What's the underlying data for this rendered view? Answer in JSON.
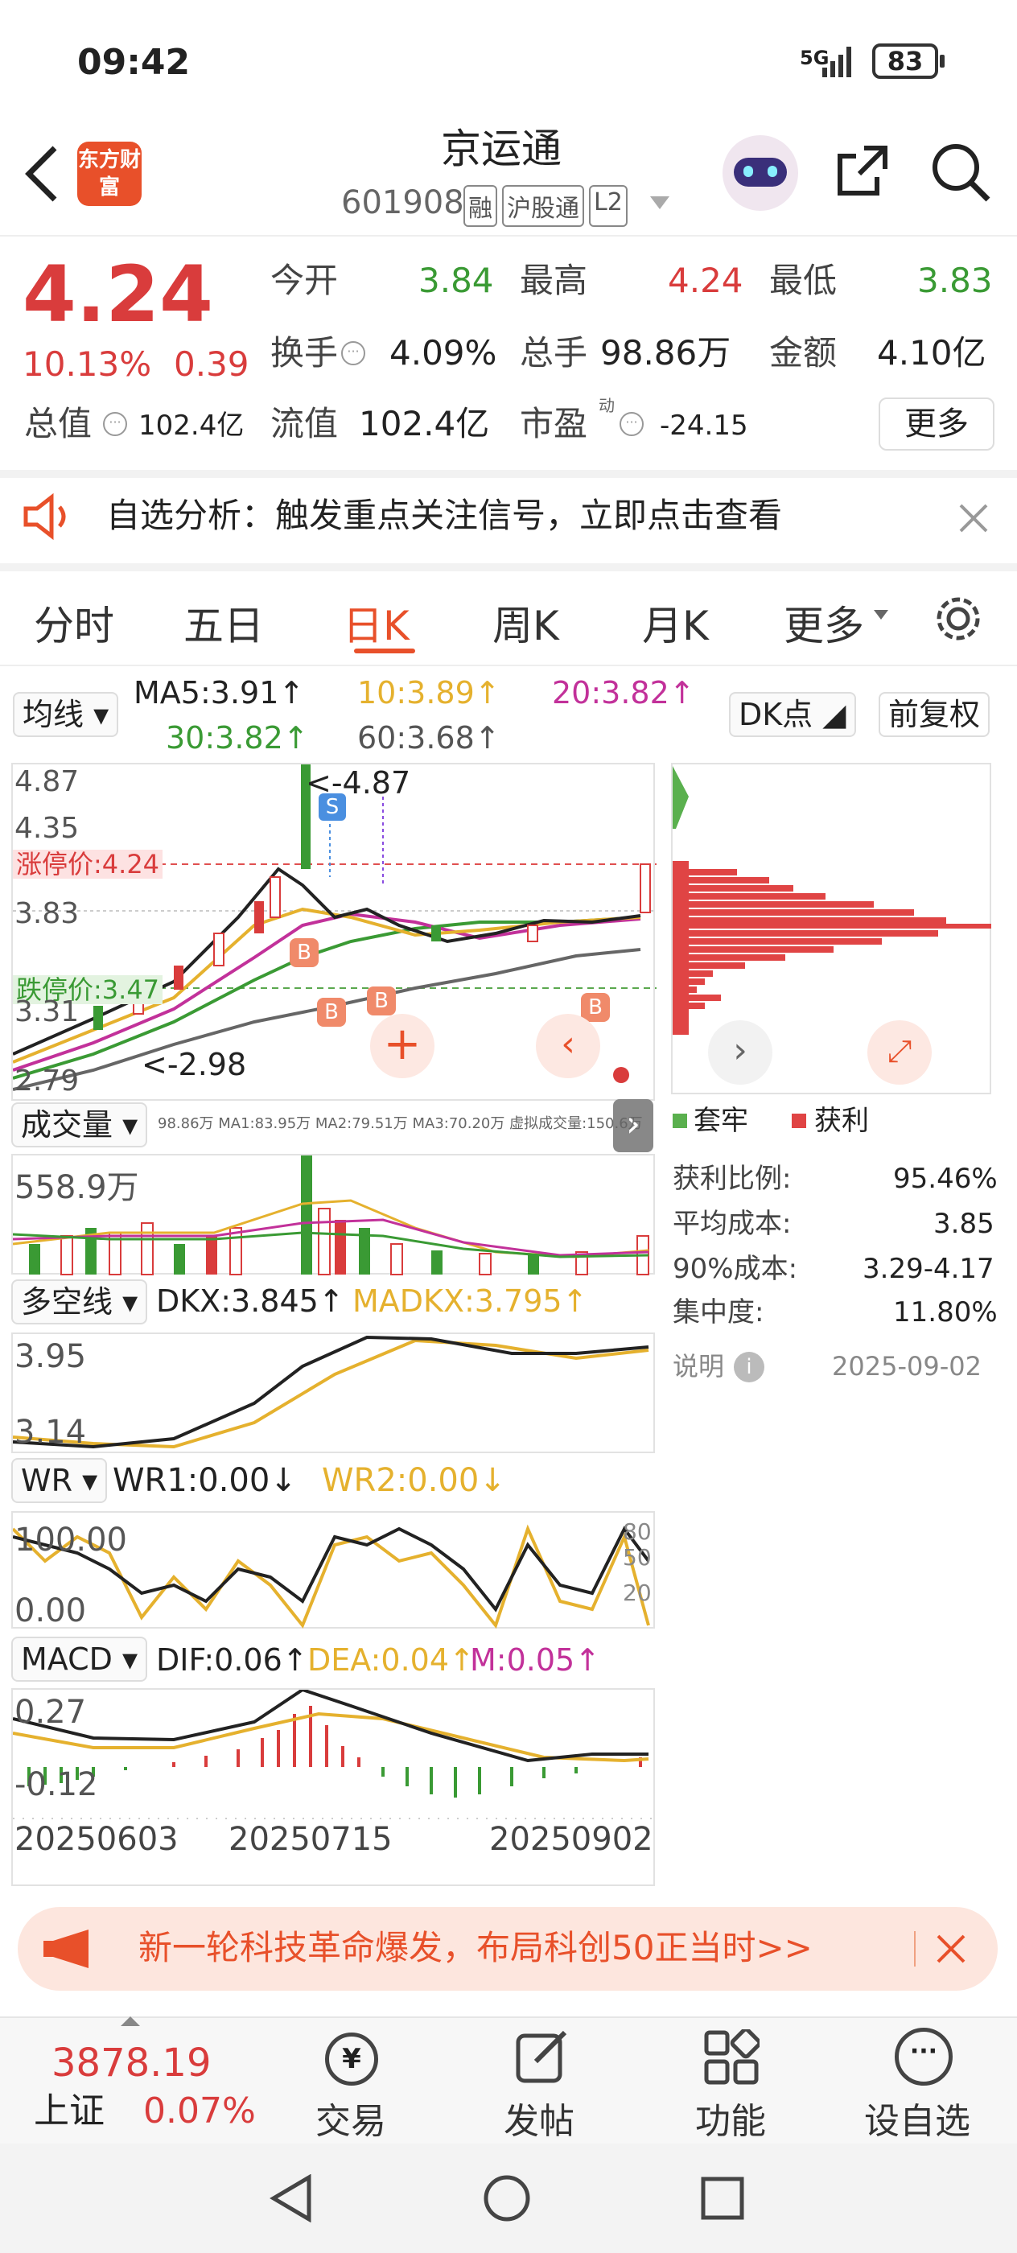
{
  "status": {
    "time": "09:42",
    "battery": "83",
    "network": "5G"
  },
  "header": {
    "title": "京运通",
    "code": "601908",
    "tags": [
      "融",
      "沪股通",
      "L2"
    ],
    "logo_text": "东方财富"
  },
  "quote": {
    "price": "4.24",
    "change_pct": "10.13%",
    "change": "0.39",
    "open_label": "今开",
    "open": "3.84",
    "high_label": "最高",
    "high": "4.24",
    "low_label": "最低",
    "low": "3.83",
    "turnover_label": "换手",
    "turnover": "4.09%",
    "volume_label": "总手",
    "volume": "98.86万",
    "amount_label": "金额",
    "amount": "4.10亿",
    "mktcap_label": "总值",
    "mktcap": "102.4亿",
    "float_label": "流值",
    "float": "102.4亿",
    "pe_label": "市盈",
    "pe_sup": "动",
    "pe": "-24.15",
    "more": "更多"
  },
  "alert": {
    "text": "自选分析：触发重点关注信号，立即点击查看"
  },
  "tabs": [
    "分时",
    "五日",
    "日K",
    "周K",
    "月K",
    "更多"
  ],
  "ma": {
    "select": "均线",
    "ma5": "MA5:3.91↑",
    "ma10": "10:3.89↑",
    "ma20": "20:3.82↑",
    "ma30": "30:3.82↑",
    "ma60": "60:3.68↑",
    "dk": "DK点",
    "adjust": "前复权"
  },
  "kline": {
    "y_top": "4.87",
    "y2": "4.35",
    "y3": "3.83",
    "y4": "3.31",
    "y_bot": "2.79",
    "limit_up": "涨停价:4.24",
    "limit_down": "跌停价:3.47",
    "max_ann": "<-4.87",
    "min_ann": "<-2.98",
    "s": "S",
    "b": "B"
  },
  "chips": {
    "legend_trap": "套牢",
    "legend_profit": "获利",
    "profit_ratio_label": "获利比例:",
    "profit_ratio": "95.46%",
    "avg_cost_label": "平均成本:",
    "avg_cost": "3.85",
    "cost90_label": "90%成本:",
    "cost90": "3.29-4.17",
    "conc_label": "集中度:",
    "conc": "11.80%",
    "note": "说明",
    "date": "2025-09-02"
  },
  "volume": {
    "select": "成交量",
    "legend": "98.86万  MA1:83.95万  MA2:79.51万  MA3:70.20万  虚拟成交量:150.6万",
    "max": "558.9万"
  },
  "dkx": {
    "select": "多空线",
    "dkx": "DKX:3.845↑",
    "madkx": "MADKX:3.795↑",
    "y_top": "3.95",
    "y_bot": "3.14"
  },
  "wr": {
    "select": "WR",
    "wr1": "WR1:0.00↓",
    "wr2": "WR2:0.00↓",
    "y_top": "100.00",
    "y_bot": "0.00",
    "r80": "80",
    "r50": "50",
    "r20": "20"
  },
  "macd": {
    "select": "MACD",
    "dif": "DIF:0.06↑",
    "dea": "DEA:0.04↑",
    "m": "M:0.05↑",
    "y_top": "0.27",
    "y_bot": "-0.12",
    "dates": [
      "20250603",
      "20250715",
      "20250902"
    ]
  },
  "banner": {
    "text": "新一轮科技革命爆发，布局科创50正当时>>"
  },
  "bottom": {
    "index_value": "3878.19",
    "index_name": "上证",
    "index_pct": "0.07%",
    "trade": "交易",
    "post": "发帖",
    "func": "功能",
    "add": "设自选"
  },
  "colors": {
    "up": "#d93c3c",
    "down": "#3a9a34",
    "accent": "#e8502a"
  }
}
